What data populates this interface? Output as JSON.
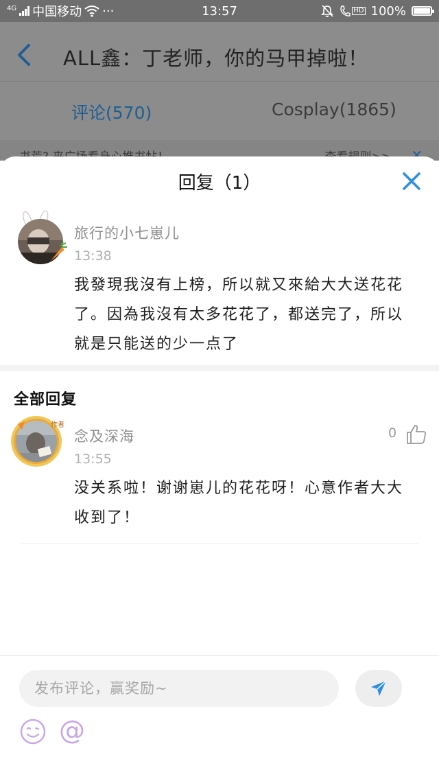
{
  "status_bar": {
    "network_label": "4G",
    "carrier": "中国移动",
    "more": "···",
    "time": "13:57",
    "hd_label": "HD",
    "battery": "100%",
    "battery_level": 1.0
  },
  "header": {
    "title": "ALL鑫：丁老师，你的马甲掉啦！"
  },
  "tabs": [
    {
      "label": "评论(570)",
      "active": true
    },
    {
      "label": "Cosplay(1865)",
      "active": false
    }
  ],
  "notice": {
    "text": "书荒? 来广场看身心推书帖！",
    "link": "查看规则>>"
  },
  "sheet": {
    "title": "回复（1）",
    "original_comment": {
      "name": "旅行的小七崽儿",
      "time": "13:38",
      "text": "我發現我沒有上榜，所以就又來給大大送花花了。因為我沒有太多花花了，都送完了，所以就是只能送的少一点了"
    },
    "section_heading": "全部回复",
    "replies": [
      {
        "name": "念及深海",
        "time": "13:55",
        "likes": "0",
        "author_badge": "作者",
        "text": "没关系啦！谢谢崽儿的花花呀！心意作者大大收到了！"
      }
    ]
  },
  "composer": {
    "placeholder": "发布评论，赢奖励~",
    "mention_label": "@"
  },
  "colors": {
    "accent": "#2e8fe0",
    "dim_overlay": "#8c8c8c",
    "emoji_purple": "#c8a6e8"
  }
}
